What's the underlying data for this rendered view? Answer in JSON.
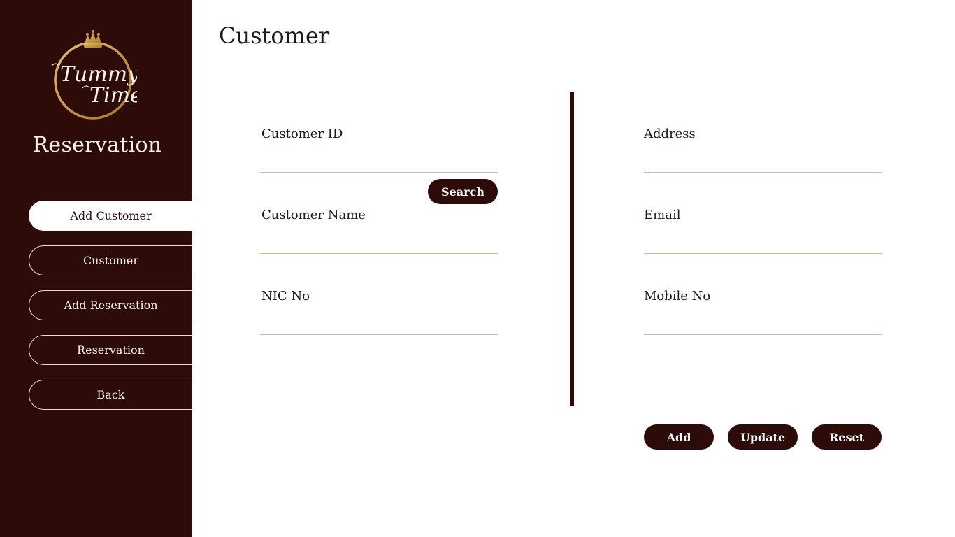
{
  "sidebar": {
    "logo_text": "Tummy Time",
    "title": "Reservation",
    "items": [
      {
        "label": "Add Customer"
      },
      {
        "label": "Customer"
      },
      {
        "label": "Add Reservation"
      },
      {
        "label": "Reservation"
      },
      {
        "label": "Back"
      }
    ]
  },
  "main": {
    "title": "Customer",
    "left_fields": {
      "customer_id": {
        "label": "Customer ID",
        "value": ""
      },
      "customer_name": {
        "label": "Customer Name",
        "value": ""
      },
      "nic_no": {
        "label": "NIC No",
        "value": ""
      }
    },
    "right_fields": {
      "address": {
        "label": "Address",
        "value": ""
      },
      "email": {
        "label": "Email",
        "value": ""
      },
      "mobile_no": {
        "label": "Mobile No",
        "value": ""
      }
    },
    "search_label": "Search",
    "actions": {
      "add": "Add",
      "update": "Update",
      "reset": "Reset"
    }
  },
  "colors": {
    "brand_dark": "#2d0b08",
    "gold": "#c99a45",
    "input_line": "#cbbd9f"
  }
}
